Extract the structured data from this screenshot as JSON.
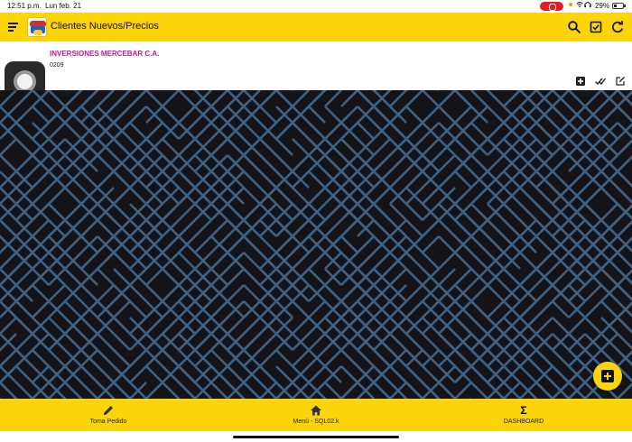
{
  "status_bar": {
    "time": "12:51 p.m.",
    "date": "Lun feb. 21",
    "battery": "29%"
  },
  "app_bar": {
    "title": "Clientes Nuevos/Precios",
    "icons": [
      "menu-icon",
      "logo",
      "search-icon",
      "check-box-icon",
      "refresh-icon"
    ]
  },
  "client": {
    "name": "INVERSIONES MERCEBAR C.A.",
    "code": "0209",
    "name_color": "#c2189e",
    "actions": [
      "add-box-icon",
      "done-all-icon",
      "edit-icon"
    ]
  },
  "colors": {
    "accent": "#fbd40a",
    "pattern_background": "#141418",
    "pattern_lines": "#3f6282"
  },
  "bottom_nav": {
    "items": [
      {
        "label": "Toma Pedido",
        "icon": "pencil-icon"
      },
      {
        "label": "Menú - SQL02.k",
        "icon": "home-icon"
      },
      {
        "label": "DASHBOARD",
        "icon": "sigma-icon"
      }
    ]
  },
  "fab": {
    "icon": "add-box-icon"
  }
}
